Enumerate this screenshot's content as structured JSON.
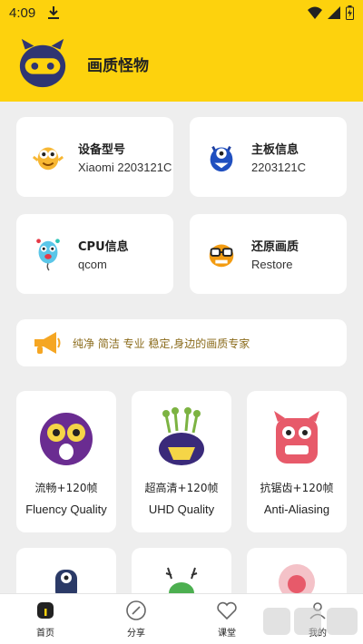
{
  "status": {
    "time": "4:09"
  },
  "app": {
    "title": "画质怪物"
  },
  "info_cards": [
    {
      "label": "设备型号",
      "value": "Xiaomi 2203121C",
      "icon": "yellow-monster-icon"
    },
    {
      "label": "主板信息",
      "value": "2203121C",
      "icon": "blue-monster-icon"
    },
    {
      "label": "CPU信息",
      "value": "qcom",
      "icon": "balloon-monster-icon"
    },
    {
      "label": "还原画质",
      "value": "Restore",
      "icon": "orange-glasses-monster-icon"
    }
  ],
  "banner": {
    "text": "纯净 简洁 专业 稳定,身边的画质专家",
    "icon": "megaphone-icon"
  },
  "modes": [
    {
      "title": "流畅+120帧",
      "subtitle": "Fluency Quality"
    },
    {
      "title": "超高清+120帧",
      "subtitle": "UHD Quality"
    },
    {
      "title": "抗锯齿+120帧",
      "subtitle": "Anti-Aliasing"
    }
  ],
  "nav": [
    {
      "label": "首页",
      "icon": "home-icon"
    },
    {
      "label": "分享",
      "icon": "compass-icon"
    },
    {
      "label": "课堂",
      "icon": "heart-icon"
    },
    {
      "label": "我的",
      "icon": "profile-icon"
    }
  ],
  "colors": {
    "accent": "#fdd20d",
    "banner_text": "#8a6a1a"
  }
}
